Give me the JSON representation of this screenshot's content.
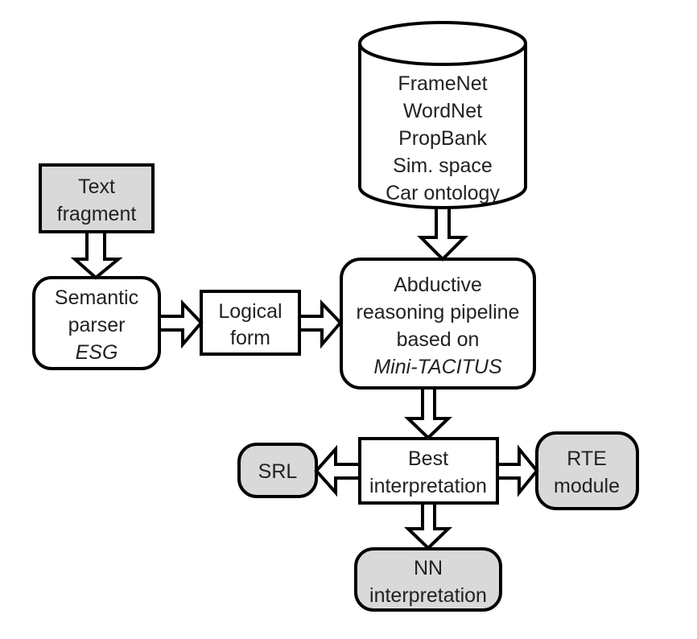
{
  "colors": {
    "input_output_fill": "#d9d9d9",
    "process_fill": "#ffffff",
    "stroke": "#000000"
  },
  "database": {
    "lines": [
      "FrameNet",
      "WordNet",
      "PropBank",
      "Sim. space",
      "Car ontology"
    ]
  },
  "text_fragment": {
    "lines": [
      "Text",
      "fragment"
    ]
  },
  "semantic_parser": {
    "lines": [
      "Semantic",
      "parser"
    ],
    "italic": "ESG"
  },
  "logical_form": {
    "lines": [
      "Logical",
      "form"
    ]
  },
  "abductive": {
    "lines": [
      "Abductive",
      "reasoning pipeline",
      "based on"
    ],
    "italic": "Mini-TACITUS"
  },
  "best_interpretation": {
    "lines": [
      "Best",
      "interpretation"
    ]
  },
  "srl": {
    "label": "SRL"
  },
  "rte": {
    "lines": [
      "RTE",
      "module"
    ]
  },
  "nn": {
    "lines": [
      "NN",
      "interpretation"
    ]
  }
}
